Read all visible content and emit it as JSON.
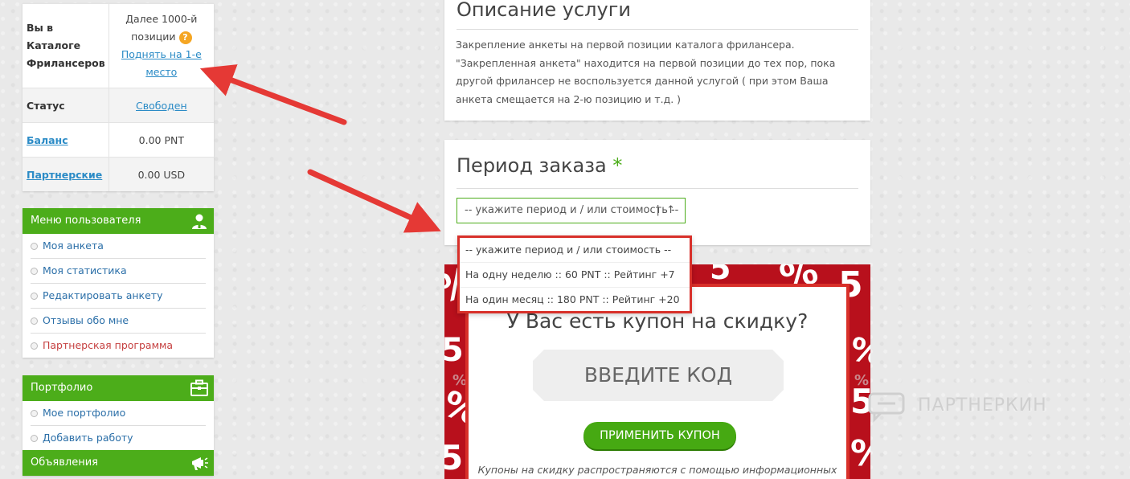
{
  "sidebar": {
    "catalog_label": "Вы в Каталоге Фрилансеров",
    "catalog_text": "Далее 1000-й позиции",
    "catalog_link": "Поднять на 1-е место",
    "status_label": "Статус",
    "status_value": "Свободен",
    "balance_label": "Баланс",
    "balance_value": "0.00 PNT",
    "partner_label": "Партнерские",
    "partner_value": "0.00 USD"
  },
  "user_menu": {
    "title": "Меню пользователя",
    "items": [
      {
        "label": "Моя анкета"
      },
      {
        "label": "Моя статистика"
      },
      {
        "label": "Редактировать анкету"
      },
      {
        "label": "Отзывы обо мне"
      },
      {
        "label": "Партнерская программа"
      }
    ]
  },
  "portfolio_menu": {
    "title": "Портфолио",
    "items": [
      {
        "label": "Мое портфолио"
      },
      {
        "label": "Добавить работу"
      }
    ]
  },
  "ads_menu": {
    "title": "Объявления"
  },
  "description": {
    "title": "Описание услуги",
    "text": "Закрепление анкеты на первой позиции каталога фрилансера. \"Закрепленная анкета\" находится на первой позиции до тех пор, пока другой фрилансер не воспользуется данной услугой ( при этом Ваша анкета смещается на 2-ю позицию и т.д. )"
  },
  "order": {
    "title": "Период заказа",
    "required_mark": "*",
    "selected": "-- укажите период и / или стоимость --",
    "options": [
      "-- укажите период и / или стоимость --",
      "На одну неделю :: 60 PNT :: Рейтинг +7",
      "На один месяц :: 180 PNT :: Рейтинг +20"
    ]
  },
  "coupon": {
    "title": "У Вас есть купон на скидку?",
    "code_placeholder": "ВВЕДИТЕ КОД",
    "apply_label": "ПРИМЕНИТЬ КУПОН",
    "note": "Купоны на скидку распространяются с помощью информационных"
  },
  "watermark": {
    "text": "ПАРТНЕРКИН"
  },
  "colors": {
    "green": "#4cad1a",
    "red": "#d8302a",
    "link": "#2b8bc6"
  }
}
